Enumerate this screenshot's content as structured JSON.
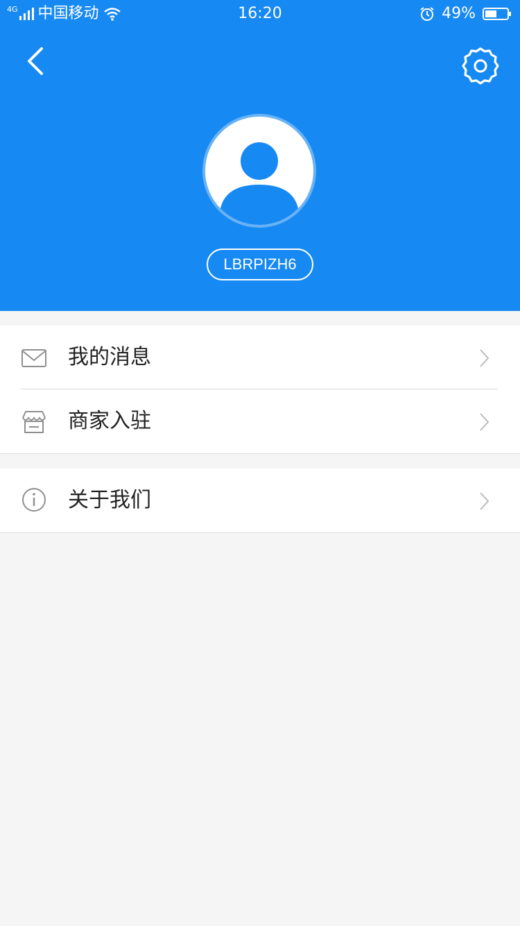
{
  "status_bar": {
    "network": "4G",
    "carrier": "中国移动",
    "time": "16:20",
    "battery": "49%"
  },
  "header": {
    "back_icon": "back-arrow-icon",
    "settings_icon": "gear-icon",
    "username": "LBRPIZH6",
    "bg_color": "#1789f2"
  },
  "menu": {
    "group1": [
      {
        "label": "我的消息",
        "icon": "mail-icon"
      },
      {
        "label": "商家入驻",
        "icon": "store-icon"
      }
    ],
    "group2": [
      {
        "label": "关于我们",
        "icon": "info-icon"
      }
    ]
  }
}
